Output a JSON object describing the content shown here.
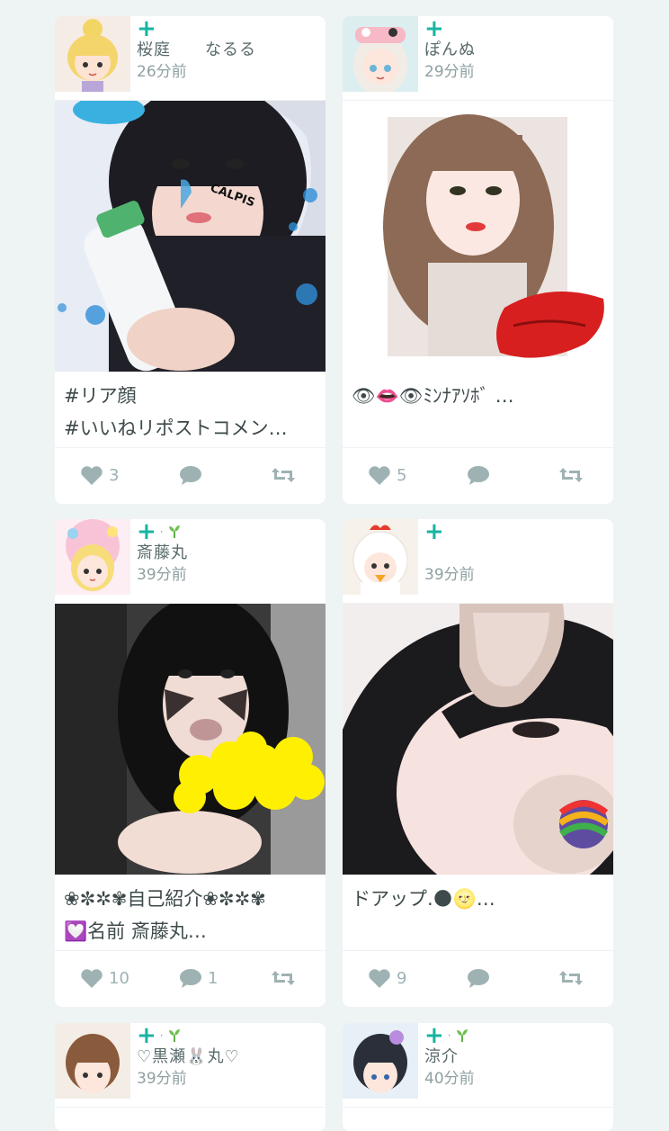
{
  "posts": [
    {
      "user": "桜庭　　なるる",
      "time": "26分前",
      "badge": "+",
      "sprout": false,
      "caption_line1": "#リア顔",
      "caption_line2": "#いいねリポストコメン…",
      "likes": "3",
      "comments": ""
    },
    {
      "user": "ぽんぬ",
      "time": "29分前",
      "badge": "+",
      "sprout": false,
      "caption_line1": "👁👄👁ﾐﾝﾅｱｿﾎﾞ …",
      "caption_line2": "",
      "likes": "5",
      "comments": ""
    },
    {
      "user": "斎藤丸",
      "time": "39分前",
      "badge": "+",
      "sprout": true,
      "caption_line1": "❀✼✲✾自己紹介❀✼✲✾",
      "caption_line2": "💟名前 斎藤丸…",
      "likes": "10",
      "comments": "1"
    },
    {
      "user": "",
      "time": "39分前",
      "badge": "+",
      "sprout": false,
      "caption_line1": "ドアップ.🌑🌝…",
      "caption_line2": "",
      "likes": "9",
      "comments": ""
    },
    {
      "user": "♡黒瀬🐰丸♡",
      "time": "39分前",
      "badge": "+",
      "sprout": true
    },
    {
      "user": "涼介",
      "time": "40分前",
      "badge": "+",
      "sprout": true
    }
  ],
  "photo_stickers": {
    "p1": "CALPIS"
  },
  "colors": {
    "accent": "#19b5a1",
    "icon": "#9fb2b3",
    "background": "#eef3f4"
  }
}
